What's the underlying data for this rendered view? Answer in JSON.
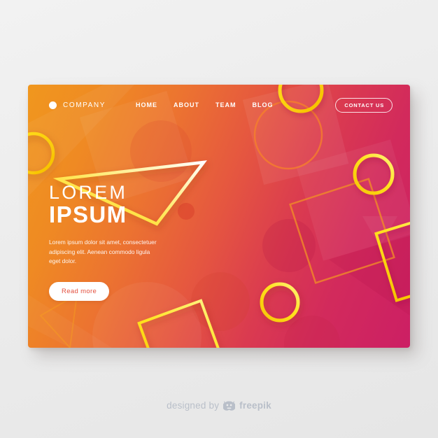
{
  "background": {
    "color": "#ececec"
  },
  "card": {
    "gradient_start": "#f0971e",
    "gradient_mid": "#e55640",
    "gradient_end": "#cc1f64",
    "accent_yellow": "#ffe01b",
    "accent_orange": "#f07d1e"
  },
  "header": {
    "brand": {
      "dot_icon": "brand-dot-icon",
      "name": "COMPANY"
    },
    "nav": [
      {
        "label": "HOME"
      },
      {
        "label": "ABOUT"
      },
      {
        "label": "TEAM"
      },
      {
        "label": "BLOG"
      }
    ],
    "contact_button": {
      "label": "CONTACT US"
    }
  },
  "hero": {
    "title_line1": "LOREM",
    "title_line2": "IPSUM",
    "description": "Lorem ipsum dolor sit amet, consectetuer adipiscing elit. Aenean commodo ligula eget dolor.",
    "cta_label": "Read more",
    "cta_color": "#e3503f"
  },
  "footer": {
    "designed_by": "designed by",
    "brand": "freepik",
    "logo_icon": "freepik-logo-icon",
    "text_color": "#b9bfc9"
  }
}
